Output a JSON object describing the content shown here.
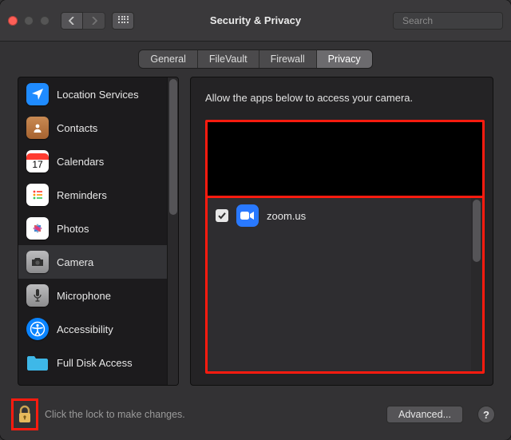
{
  "window": {
    "title": "Security & Privacy"
  },
  "search": {
    "placeholder": "Search"
  },
  "tabs": [
    {
      "label": "General"
    },
    {
      "label": "FileVault"
    },
    {
      "label": "Firewall"
    },
    {
      "label": "Privacy",
      "active": true
    }
  ],
  "sidebar": {
    "items": [
      {
        "id": "location",
        "label": "Location Services"
      },
      {
        "id": "contacts",
        "label": "Contacts"
      },
      {
        "id": "calendars",
        "label": "Calendars"
      },
      {
        "id": "reminders",
        "label": "Reminders"
      },
      {
        "id": "photos",
        "label": "Photos"
      },
      {
        "id": "camera",
        "label": "Camera",
        "selected": true
      },
      {
        "id": "microphone",
        "label": "Microphone"
      },
      {
        "id": "accessibility",
        "label": "Accessibility"
      },
      {
        "id": "fulldisk",
        "label": "Full Disk Access"
      }
    ]
  },
  "main": {
    "heading": "Allow the apps below to access your camera.",
    "apps": [
      {
        "name": "zoom.us",
        "checked": true
      }
    ]
  },
  "footer": {
    "lock_text": "Click the lock to make changes.",
    "advanced_label": "Advanced...",
    "help_label": "?"
  }
}
